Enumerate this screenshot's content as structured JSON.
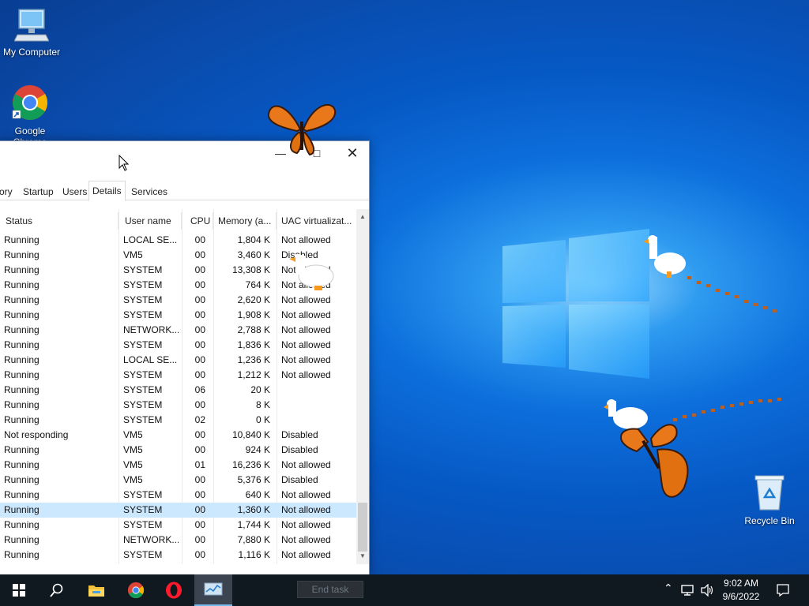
{
  "desktop": {
    "icons": [
      {
        "label": "My Computer",
        "icon": "computer-icon"
      },
      {
        "label": "Google\nChrome",
        "icon": "chrome-icon"
      },
      {
        "label": "Recycle Bin",
        "icon": "recycle-bin-icon"
      }
    ]
  },
  "task_manager": {
    "tabs": [
      {
        "label": "ory"
      },
      {
        "label": "Startup"
      },
      {
        "label": "Users"
      },
      {
        "label": "Details",
        "active": true
      },
      {
        "label": "Services"
      }
    ],
    "columns": [
      "Status",
      "User name",
      "CPU",
      "Memory (a...",
      "UAC virtualizat..."
    ],
    "rows": [
      {
        "status": "Running",
        "user": "LOCAL SE...",
        "cpu": "00",
        "mem": "1,804 K",
        "uac": "Not allowed"
      },
      {
        "status": "Running",
        "user": "VM5",
        "cpu": "00",
        "mem": "3,460 K",
        "uac": "Disabled"
      },
      {
        "status": "Running",
        "user": "SYSTEM",
        "cpu": "00",
        "mem": "13,308 K",
        "uac": "Not allowed"
      },
      {
        "status": "Running",
        "user": "SYSTEM",
        "cpu": "00",
        "mem": "764 K",
        "uac": "Not allowed"
      },
      {
        "status": "Running",
        "user": "SYSTEM",
        "cpu": "00",
        "mem": "2,620 K",
        "uac": "Not allowed"
      },
      {
        "status": "Running",
        "user": "SYSTEM",
        "cpu": "00",
        "mem": "1,908 K",
        "uac": "Not allowed"
      },
      {
        "status": "Running",
        "user": "NETWORK...",
        "cpu": "00",
        "mem": "2,788 K",
        "uac": "Not allowed"
      },
      {
        "status": "Running",
        "user": "SYSTEM",
        "cpu": "00",
        "mem": "1,836 K",
        "uac": "Not allowed"
      },
      {
        "status": "Running",
        "user": "LOCAL SE...",
        "cpu": "00",
        "mem": "1,236 K",
        "uac": "Not allowed"
      },
      {
        "status": "Running",
        "user": "SYSTEM",
        "cpu": "00",
        "mem": "1,212 K",
        "uac": "Not allowed"
      },
      {
        "status": "Running",
        "user": "SYSTEM",
        "cpu": "06",
        "mem": "20 K",
        "uac": ""
      },
      {
        "status": "Running",
        "user": "SYSTEM",
        "cpu": "00",
        "mem": "8 K",
        "uac": ""
      },
      {
        "status": "Running",
        "user": "SYSTEM",
        "cpu": "02",
        "mem": "0 K",
        "uac": ""
      },
      {
        "status": "Not responding",
        "user": "VM5",
        "cpu": "00",
        "mem": "10,840 K",
        "uac": "Disabled"
      },
      {
        "status": "Running",
        "user": "VM5",
        "cpu": "00",
        "mem": "924 K",
        "uac": "Disabled"
      },
      {
        "status": "Running",
        "user": "VM5",
        "cpu": "01",
        "mem": "16,236 K",
        "uac": "Not allowed"
      },
      {
        "status": "Running",
        "user": "VM5",
        "cpu": "00",
        "mem": "5,376 K",
        "uac": "Disabled"
      },
      {
        "status": "Running",
        "user": "SYSTEM",
        "cpu": "00",
        "mem": "640 K",
        "uac": "Not allowed"
      },
      {
        "status": "Running",
        "user": "SYSTEM",
        "cpu": "00",
        "mem": "1,360 K",
        "uac": "Not allowed",
        "selected": true
      },
      {
        "status": "Running",
        "user": "SYSTEM",
        "cpu": "00",
        "mem": "1,744 K",
        "uac": "Not allowed"
      },
      {
        "status": "Running",
        "user": "NETWORK...",
        "cpu": "00",
        "mem": "7,880 K",
        "uac": "Not allowed"
      },
      {
        "status": "Running",
        "user": "SYSTEM",
        "cpu": "00",
        "mem": "1,116 K",
        "uac": "Not allowed"
      }
    ],
    "end_task_label": "End task"
  },
  "taskbar": {
    "clock_time": "9:02 AM",
    "clock_date": "9/6/2022"
  }
}
